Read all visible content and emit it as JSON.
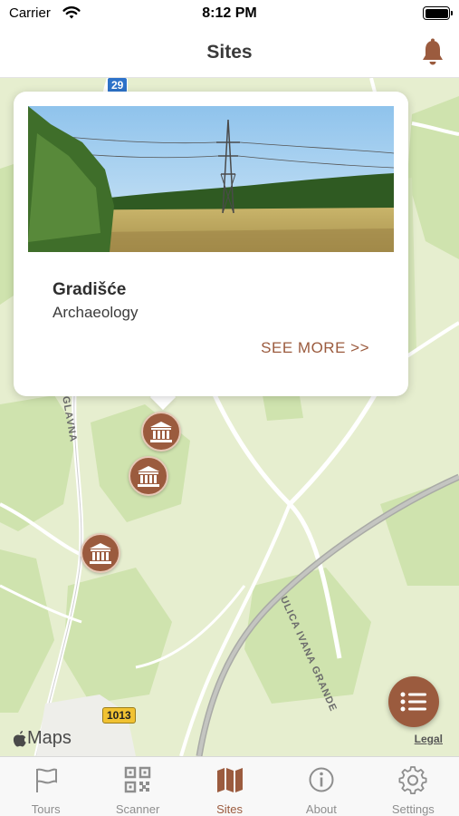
{
  "status_bar": {
    "carrier": "Carrier",
    "time": "8:12 PM"
  },
  "nav": {
    "title": "Sites"
  },
  "map": {
    "road_labels": [
      "ULICA IVANA GRANDE",
      "GLAVNA"
    ],
    "shields": [
      "29",
      "1013"
    ],
    "attribution": "Maps",
    "legal": "Legal"
  },
  "callout": {
    "site_name": "Gradišće",
    "category": "Archaeology",
    "see_more": "SEE MORE >>"
  },
  "tabs": [
    {
      "label": "Tours",
      "icon": "flag-icon"
    },
    {
      "label": "Scanner",
      "icon": "qr-code-icon"
    },
    {
      "label": "Sites",
      "icon": "map-icon",
      "active": true
    },
    {
      "label": "About",
      "icon": "info-icon"
    },
    {
      "label": "Settings",
      "icon": "gear-icon"
    }
  ],
  "colors": {
    "accent": "#9b5b3e",
    "map_base": "#e6eecf",
    "forest": "#cfe3ae"
  }
}
